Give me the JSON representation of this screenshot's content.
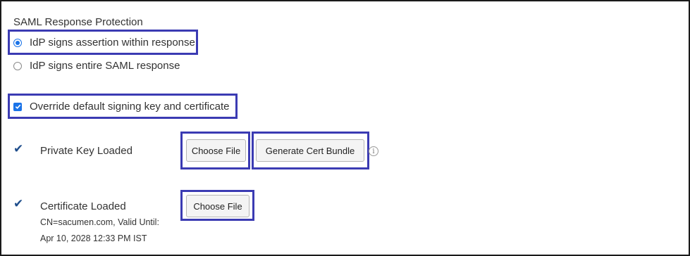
{
  "saml_response_protection": {
    "title": "SAML Response Protection",
    "options": [
      {
        "label": "IdP signs assertion within response",
        "selected": true
      },
      {
        "label": "IdP signs entire SAML response",
        "selected": false
      }
    ]
  },
  "override_signing": {
    "label": "Override default signing key and certificate",
    "checked": true
  },
  "private_key": {
    "status_icon": "checkmark-icon",
    "label": "Private Key Loaded",
    "choose_file_label": "Choose File",
    "generate_label": "Generate Cert Bundle",
    "info_icon": "info-icon",
    "info_glyph": "i"
  },
  "certificate": {
    "status_icon": "checkmark-icon",
    "label": "Certificate Loaded",
    "detail_line1": "CN=sacumen.com, Valid Until:",
    "detail_line2": "Apr 10, 2028 12:33 PM IST",
    "choose_file_label": "Choose File"
  },
  "colors": {
    "highlight_border": "#3b3bb3",
    "accent": "#1a73e8",
    "checkmark": "#1f4e8c"
  }
}
